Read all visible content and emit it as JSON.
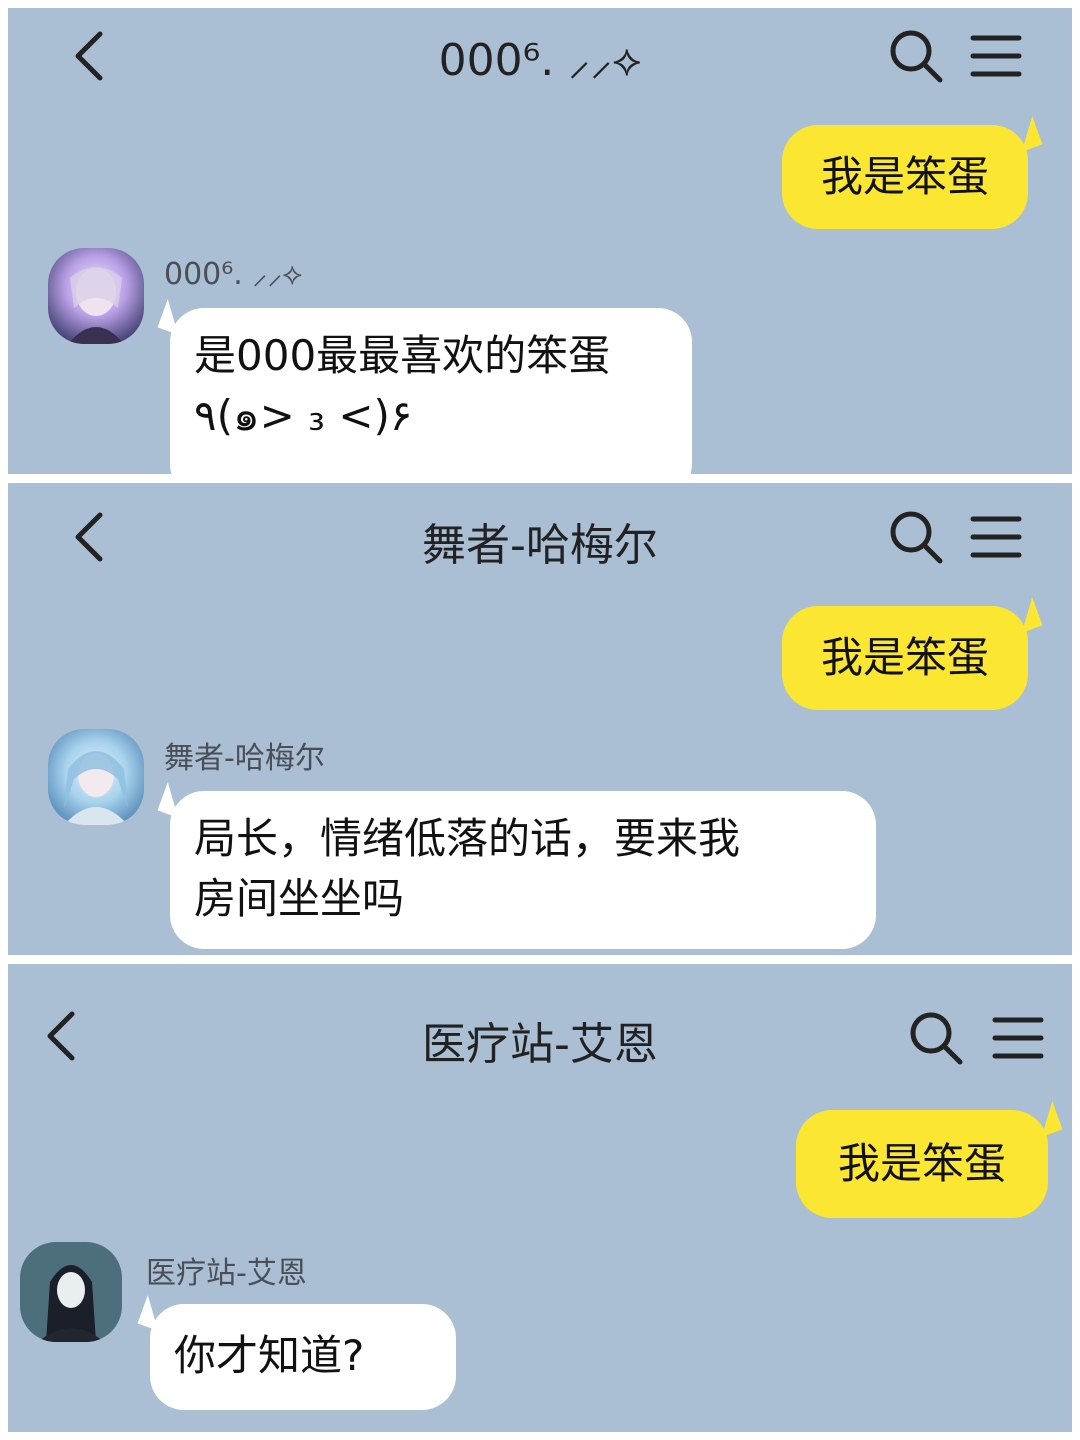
{
  "chats": [
    {
      "title": "000⁶. ⸝⸝⟡",
      "sent_message": "我是笨蛋",
      "sender_name": "000⁶. ⸝⸝⟡",
      "reply_lines": [
        "是000最最喜欢的笨蛋",
        "٩(๑> ₃ <)۶"
      ],
      "avatar_colors": [
        "#2b2f5c",
        "#b9a0e6",
        "#f1e7f7"
      ]
    },
    {
      "title": "舞者-哈梅尔",
      "sent_message": "我是笨蛋",
      "sender_name": "舞者-哈梅尔",
      "reply_lines": [
        "局长，情绪低落的话，要来我",
        "房间坐坐吗"
      ],
      "avatar_colors": [
        "#3f77a8",
        "#a9d3ee",
        "#e7f1f8"
      ]
    },
    {
      "title": "医疗站-艾恩",
      "sent_message": "我是笨蛋",
      "sender_name": "医疗站-艾恩",
      "reply_lines": [
        "你才知道?"
      ],
      "avatar_colors": [
        "#4d6f7c",
        "#1b1f2a",
        "#e9eef0"
      ]
    }
  ],
  "icons": {
    "back": "chevron-left-icon",
    "search": "search-icon",
    "menu": "hamburger-menu-icon"
  },
  "colors": {
    "chat_background": "#aabfd3",
    "outgoing_bubble": "#fbe731",
    "incoming_bubble": "#ffffff"
  }
}
